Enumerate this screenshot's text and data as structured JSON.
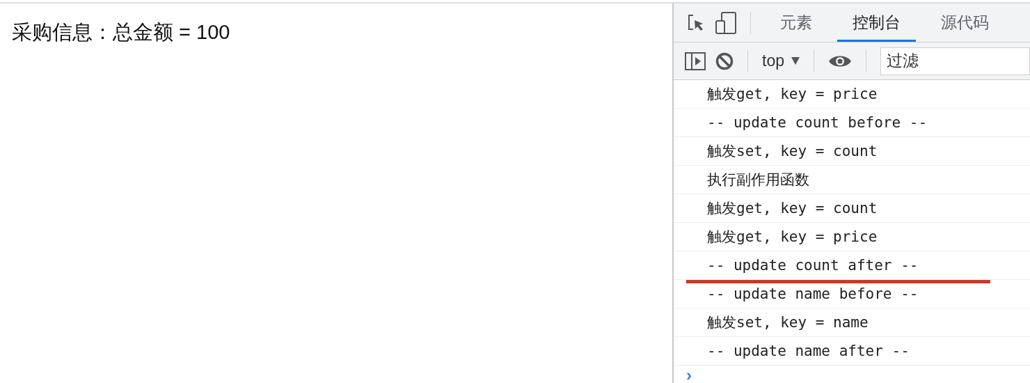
{
  "page": {
    "text": "采购信息：总金额 = 100"
  },
  "devtools": {
    "tabs": [
      {
        "label": "元素",
        "selected": false
      },
      {
        "label": "控制台",
        "selected": true
      },
      {
        "label": "源代码",
        "selected": false
      }
    ],
    "context": "top",
    "filter": {
      "placeholder": "过滤"
    },
    "logs": [
      {
        "text": "触发get, key = price",
        "underlined": false
      },
      {
        "text": "-- update count before --",
        "underlined": false
      },
      {
        "text": "触发set, key = count",
        "underlined": false
      },
      {
        "text": "执行副作用函数",
        "underlined": false
      },
      {
        "text": "触发get, key = count",
        "underlined": false
      },
      {
        "text": "触发get, key = price",
        "underlined": false
      },
      {
        "text": "-- update count after --",
        "underlined": true
      },
      {
        "text": "-- update name before --",
        "underlined": false
      },
      {
        "text": "触发set, key = name",
        "underlined": false
      },
      {
        "text": "-- update name after --",
        "underlined": false
      }
    ],
    "prompt": "›"
  }
}
